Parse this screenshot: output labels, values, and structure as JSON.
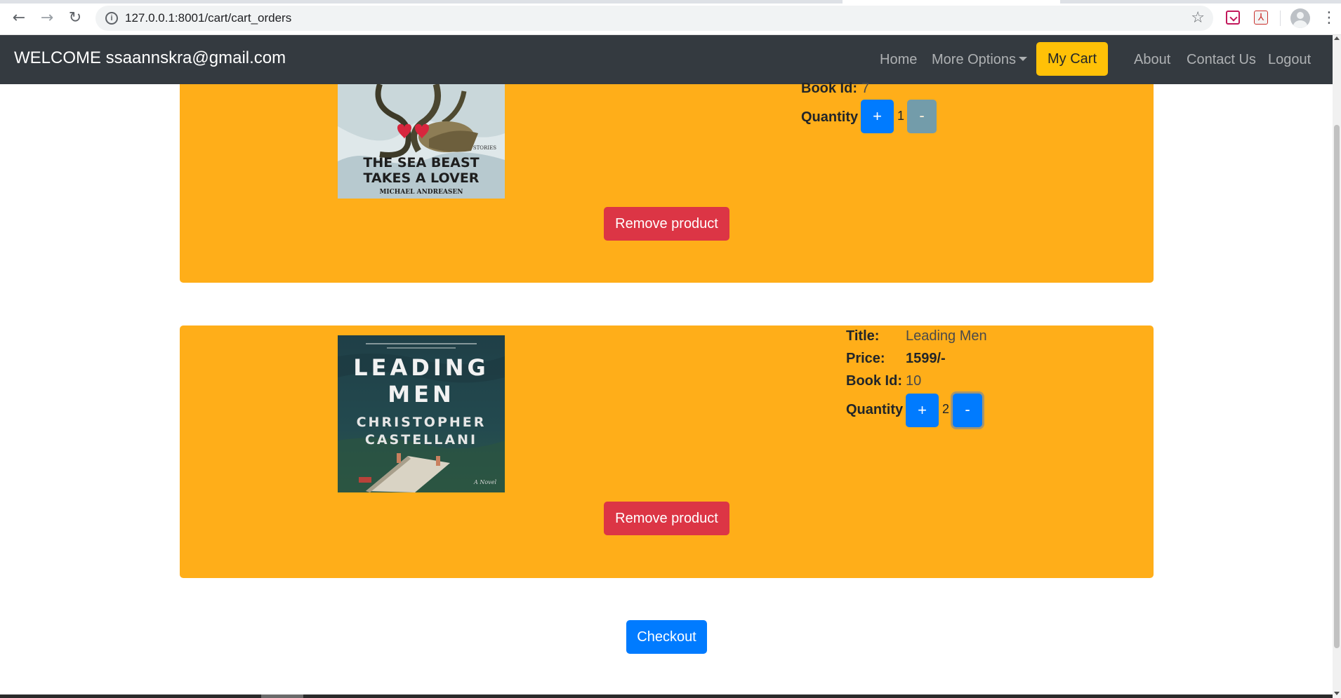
{
  "browser": {
    "url": "127.0.0.1:8001/cart/cart_orders",
    "back_glyph": "←",
    "forward_glyph": "→",
    "reload_glyph": "↻",
    "star_glyph": "☆",
    "menu_glyph": "⋮",
    "pdf_glyph": "⅄"
  },
  "navbar": {
    "brand": "WELCOME ssaannskra@gmail.com",
    "links": [
      "Home",
      "More Options",
      "My Cart",
      "About",
      "Contact Us",
      "Logout"
    ]
  },
  "cart": {
    "items": [
      {
        "cover_text": [
          "THE SEA BEAST",
          "TAKES A LOVER",
          "MICHAEL ANDREASEN",
          "STORIES"
        ],
        "labels": {
          "book_id": "Book Id:",
          "quantity": "Quantity"
        },
        "book_id": "7",
        "quantity": "1",
        "plus": "+",
        "minus": "-",
        "remove": "Remove product"
      },
      {
        "cover_text": [
          "LEADING",
          "MEN",
          "CHRISTOPHER",
          "CASTELLANI",
          "A Novel"
        ],
        "labels": {
          "title": "Title:",
          "price": "Price:",
          "book_id": "Book Id:",
          "quantity": "Quantity"
        },
        "title": "Leading Men",
        "price": "1599/-",
        "book_id": "10",
        "quantity": "2",
        "plus": "+",
        "minus": "-",
        "remove": "Remove product"
      }
    ],
    "checkout": "Checkout"
  },
  "colors": {
    "navbar": "#343a40",
    "card": "#ffae19",
    "primary": "#007bff",
    "danger": "#dc3545",
    "warning": "#ffc107"
  }
}
